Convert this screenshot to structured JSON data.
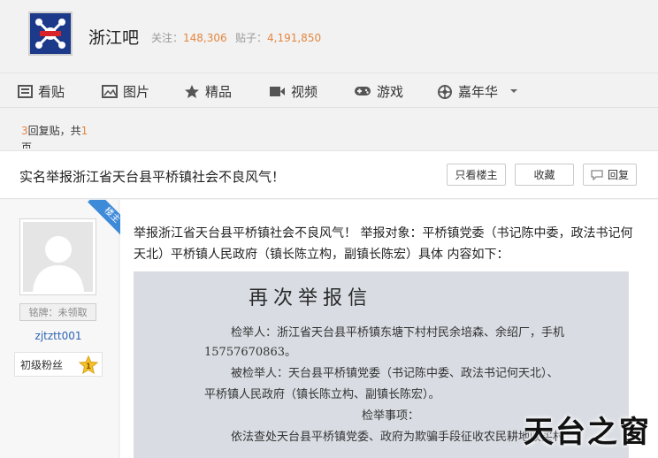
{
  "forum": {
    "name": "浙江吧",
    "follow_label": "关注：",
    "follow_count": "148,306",
    "posts_label": "贴子：",
    "posts_count": "4,191,850"
  },
  "nav": {
    "items": [
      {
        "label": "看贴",
        "icon": "list-icon"
      },
      {
        "label": "图片",
        "icon": "image-icon"
      },
      {
        "label": "精品",
        "icon": "star-icon"
      },
      {
        "label": "视频",
        "icon": "video-icon"
      },
      {
        "label": "游戏",
        "icon": "gamepad-icon"
      },
      {
        "label": "嘉年华",
        "icon": "carnival-icon"
      }
    ]
  },
  "thread": {
    "reply_count": "3",
    "reply_text": "回复贴，共",
    "page_count": "1",
    "page_unit": "页",
    "title": "实名举报浙江省天台县平桥镇社会不良风气！",
    "btn_only_op": "只看楼主",
    "btn_favorite": "收藏",
    "btn_reply": "回复"
  },
  "author": {
    "ribbon": "楼主",
    "badge": "铭牌：未领取",
    "username": "zjtztt001",
    "level_title": "初级粉丝",
    "level_num": "1"
  },
  "post": {
    "body": "举报浙江省天台县平桥镇社会不良风气！ 举报对象：平桥镇党委（书记陈中委，政法书记何天北）平桥镇人民政府（镇长陈立构，副镇长陈宏）具体 内容如下：",
    "doc": {
      "title": "再次举报信",
      "line1": "检举人：浙江省天台县平桥镇东塘下村村民余培森、余绍厂，手机",
      "line2": "15757670863。",
      "line3": "被检举人：天台县平桥镇党委（书记陈中委、政法书记何天北）、",
      "line4": "平桥镇人民政府（镇长陈立构、副镇长陈宏）。",
      "line5": "检举事项：",
      "line6": "依法查处天台县平桥镇党委、政府为欺骗手段征收农民耕地收买村"
    },
    "watermark": "天台之窗"
  }
}
